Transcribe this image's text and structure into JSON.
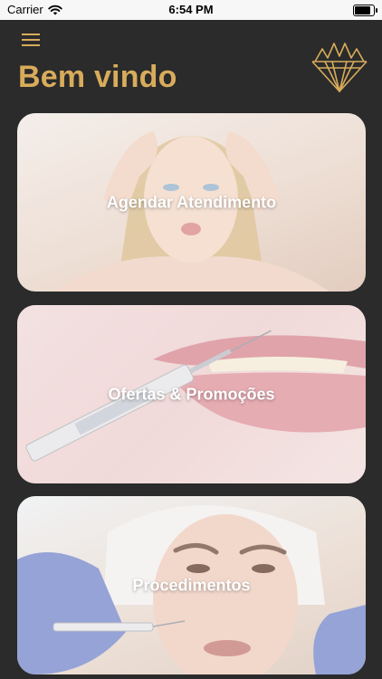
{
  "status_bar": {
    "carrier": "Carrier",
    "time": "6:54 PM",
    "battery_level": 0.95
  },
  "header": {
    "menu_icon": "hamburger-menu-icon",
    "title": "Bem vindo",
    "logo_icon": "crown-diamond-logo-icon"
  },
  "cards": [
    {
      "label": "Agendar Atendimento",
      "image": "woman-face-forehead-photo"
    },
    {
      "label": "Ofertas & Promoções",
      "image": "lips-syringe-photo"
    },
    {
      "label": "Procedimentos",
      "image": "face-injection-procedure-photo"
    }
  ],
  "colors": {
    "background": "#2b2b2b",
    "accent_gold": "#d8ac5b",
    "status_bar_bg": "#f7f7f7",
    "card_label": "#ffffff"
  }
}
